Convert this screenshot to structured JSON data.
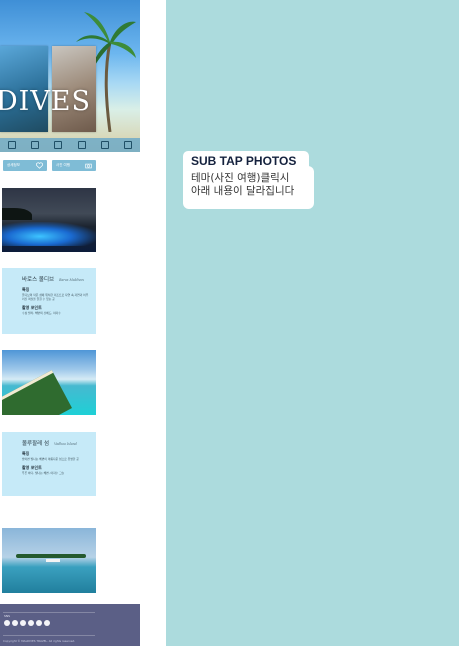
{
  "hero": {
    "title": "DIVES",
    "strip_icons": [
      "document-icon",
      "plane-icon",
      "boat-icon",
      "anchor-icon",
      "wave-icon",
      "palm-icon"
    ]
  },
  "buttons": {
    "left_label": "상세정보",
    "right_label": "사진 여행"
  },
  "cards": [
    {
      "title": "바로스 몰디브",
      "subtitle": "Baros Maldives",
      "h1": "특징",
      "t1": "몰디브의 작은 섬에 위치한 리조트로 자연 속 자연과 어우러진 객실을 즐길 수 있는 곳",
      "h2": "촬영 포인트",
      "t2": "수상 빌라, 해변의 선베드, 야자수"
    },
    {
      "title": "몰루팔레 섬",
      "subtitle": "Vadhoo Island",
      "h1": "특징",
      "t1": "밤이면 빛나는 해변이 아름다운 섬으로 유명한 곳",
      "h2": "촬영 포인트",
      "t2": "푸른 바다, 빛나는 해변, 야자수 그늘"
    }
  ],
  "footer": {
    "label": "SNS",
    "social_icons": [
      "instagram-icon",
      "facebook-icon",
      "twitter-icon",
      "blog-icon",
      "kakao-icon",
      "youtube-icon"
    ],
    "copyright": "Copyright © MALDIVES TRAVEL. All rights reserved."
  },
  "callout": {
    "tag": "SUB TAP PHOTOS",
    "line1": "테마(사진 여행)클릭시",
    "line2": "아래 내용이 달라집니다"
  },
  "colors": {
    "background_right": "#acdbdd",
    "card_bg": "#c6eaf8",
    "button": "#7fbcd6",
    "footer": "#5b5f86",
    "callout_text": "#14213d"
  }
}
